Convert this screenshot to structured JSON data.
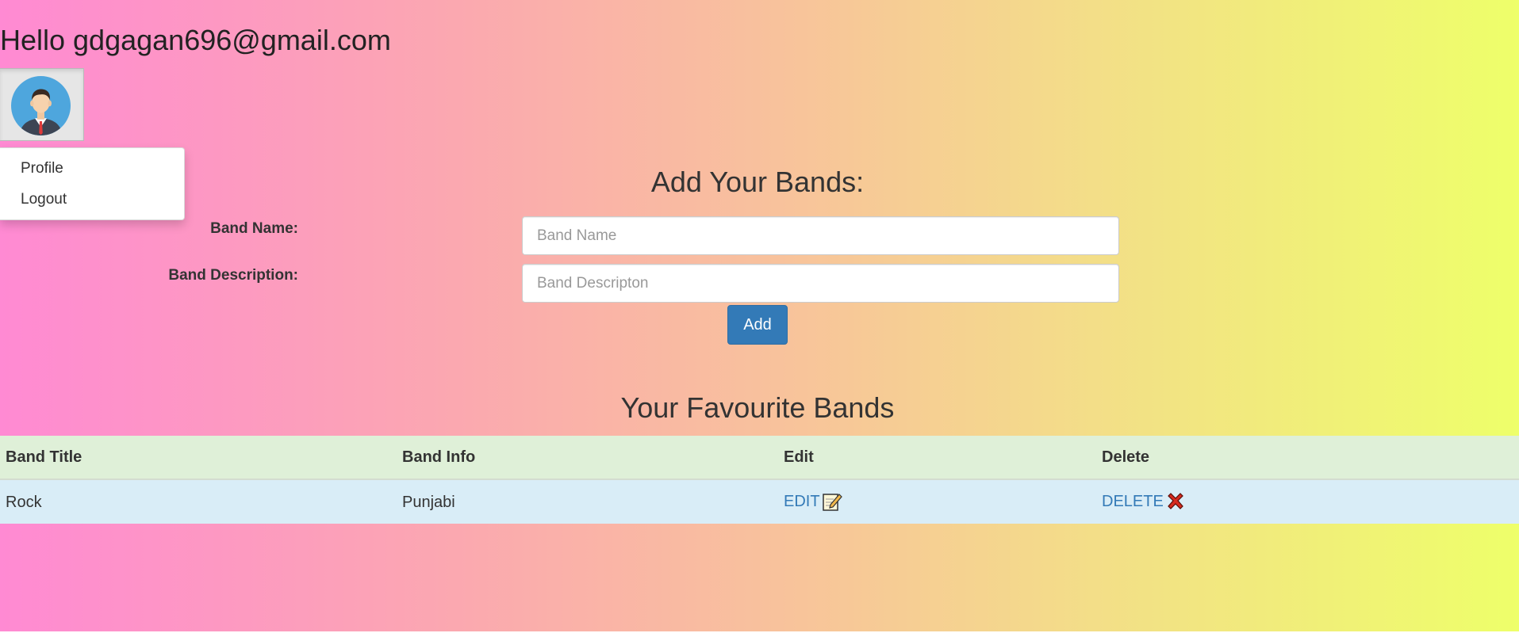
{
  "header": {
    "greeting": "Hello gdgagan696@gmail.com"
  },
  "user_menu": {
    "avatar_icon": "user-avatar-icon",
    "items": [
      {
        "label": "Profile"
      },
      {
        "label": "Logout"
      }
    ]
  },
  "add_form": {
    "title": "Add Your Bands:",
    "band_name_label": "Band Name:",
    "band_name_placeholder": "Band Name",
    "band_name_value": "",
    "band_description_label": "Band Description:",
    "band_description_placeholder": "Band Descripton",
    "band_description_value": "",
    "add_button_label": "Add"
  },
  "favourites": {
    "title": "Your Favourite Bands",
    "columns": [
      "Band Title",
      "Band Info",
      "Edit",
      "Delete"
    ],
    "rows": [
      {
        "title": "Rock",
        "info": "Punjabi",
        "edit_label": "EDIT",
        "edit_icon": "edit-note-icon",
        "delete_label": "DELETE",
        "delete_icon": "red-x-icon"
      }
    ]
  },
  "colors": {
    "gradient_left": "#ff8ad3",
    "gradient_right": "#eeff6a",
    "primary_button": "#337ab7",
    "table_header_bg": "#dff0d8",
    "table_row_bg": "#d9edf7",
    "link": "#337ab7",
    "delete_icon": "#d62b1f"
  }
}
